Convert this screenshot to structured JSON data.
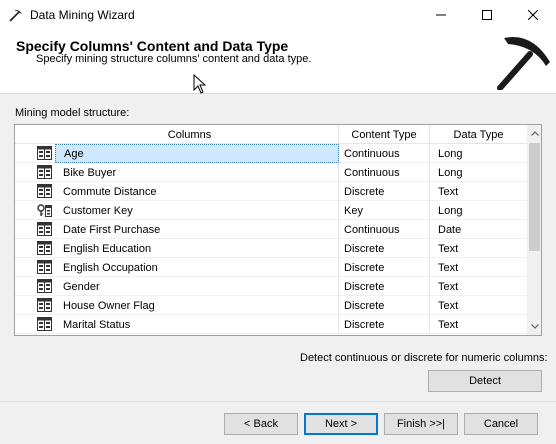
{
  "window": {
    "title": "Data Mining Wizard"
  },
  "header": {
    "title": "Specify Columns' Content and Data Type",
    "subtitle": "Specify mining structure columns' content and data type."
  },
  "structure_label": "Mining model structure:",
  "grid": {
    "headers": {
      "columns": "Columns",
      "content_type": "Content Type",
      "data_type": "Data Type"
    },
    "rows": [
      {
        "icon": "column-icon",
        "name": "Age",
        "content_type": "Continuous",
        "data_type": "Long",
        "selected": true
      },
      {
        "icon": "column-icon",
        "name": "Bike Buyer",
        "content_type": "Continuous",
        "data_type": "Long"
      },
      {
        "icon": "column-icon",
        "name": "Commute Distance",
        "content_type": "Discrete",
        "data_type": "Text"
      },
      {
        "icon": "key-column-icon",
        "name": "Customer Key",
        "content_type": "Key",
        "data_type": "Long"
      },
      {
        "icon": "column-icon",
        "name": "Date First Purchase",
        "content_type": "Continuous",
        "data_type": "Date"
      },
      {
        "icon": "column-icon",
        "name": "English Education",
        "content_type": "Discrete",
        "data_type": "Text"
      },
      {
        "icon": "column-icon",
        "name": "English Occupation",
        "content_type": "Discrete",
        "data_type": "Text"
      },
      {
        "icon": "column-icon",
        "name": "Gender",
        "content_type": "Discrete",
        "data_type": "Text"
      },
      {
        "icon": "column-icon",
        "name": "House Owner Flag",
        "content_type": "Discrete",
        "data_type": "Text"
      },
      {
        "icon": "column-icon",
        "name": "Marital Status",
        "content_type": "Discrete",
        "data_type": "Text"
      }
    ]
  },
  "detect": {
    "label": "Detect continuous or discrete for numeric columns:",
    "button": "Detect"
  },
  "footer": {
    "back": "< Back",
    "next": "Next >",
    "finish": "Finish >>|",
    "cancel": "Cancel"
  },
  "colors": {
    "selection": "#cde8ff",
    "focus_border": "#0078d7"
  }
}
